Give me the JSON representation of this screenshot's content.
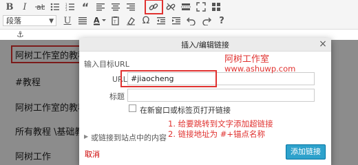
{
  "toolbar": {
    "format_value": "段落",
    "icons_row1": [
      "bold-icon",
      "italic-icon",
      "strikethrough-icon",
      "bullet-list-icon",
      "numbered-list-icon",
      "blockquote-icon",
      "align-left-icon",
      "align-center-icon",
      "align-right-icon",
      "link-icon",
      "unlink-icon",
      "insert-more-icon",
      "fullscreen-icon",
      "toolbar-toggle-icon"
    ],
    "icons_row2": [
      "underline-icon",
      "align-justify-icon",
      "text-color-icon",
      "paste-text-icon",
      "clear-format-icon",
      "special-char-icon",
      "outdent-icon",
      "indent-icon",
      "undo-icon",
      "redo-icon",
      "help-icon"
    ]
  },
  "editor": {
    "anchor_glyph": "⚓",
    "paragraphs": [
      "阿树工作室的教程",
      "#教程",
      "阿树工作室的教程",
      "所有教程 \\基础教",
      "阿树工作"
    ]
  },
  "dialog": {
    "title": "插入/编辑链接",
    "close": "×",
    "section_label": "输入目标URL",
    "url_label": "URL",
    "url_value": "#jiaocheng",
    "title_label": "标题",
    "title_value": "",
    "new_tab_label": "在新窗口或标签页打开链接",
    "existing_content_label": "或链接到站点中的内容",
    "cancel_label": "取消",
    "submit_label": "添加链接"
  },
  "annotations": {
    "site_name": "阿树工作室",
    "site_url": "www.ashuwp.com",
    "step1": "1. 给要跳转到文字添加超链接",
    "step2": "2. 链接地址为 #+锚点名称"
  },
  "colors": {
    "annotation": "#e0312f",
    "primary_button": "#2ea2cc"
  }
}
